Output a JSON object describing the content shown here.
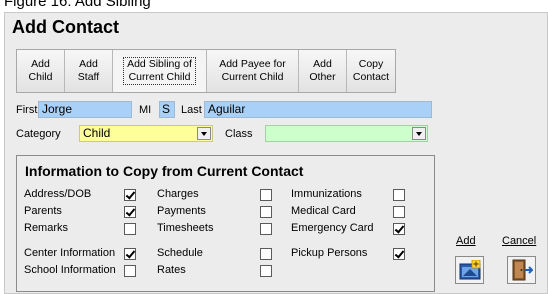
{
  "caption": "Figure 16: Add Sibling",
  "title": "Add Contact",
  "toolbar": [
    {
      "line1": "Add",
      "line2": "Child"
    },
    {
      "line1": "Add",
      "line2": "Staff"
    },
    {
      "line1": "Add Sibling of",
      "line2": "Current Child"
    },
    {
      "line1": "Add Payee for",
      "line2": "Current Child"
    },
    {
      "line1": "Add",
      "line2": "Other"
    },
    {
      "line1": "Copy",
      "line2": "Contact"
    }
  ],
  "fields": {
    "first_label": "First",
    "first_value": "Jorge",
    "mi_label": "MI",
    "mi_value": "S",
    "last_label": "Last",
    "last_value": "Aguilar",
    "category_label": "Category",
    "category_value": "Child",
    "class_label": "Class",
    "class_value": ""
  },
  "info": {
    "title": "Information to Copy from Current Contact",
    "options": [
      {
        "label": "Address/DOB",
        "checked": true
      },
      {
        "label": "Parents",
        "checked": true
      },
      {
        "label": "Remarks",
        "checked": false
      },
      {
        "label": "Center Information",
        "checked": true
      },
      {
        "label": "School Information",
        "checked": false
      },
      {
        "label": "Charges",
        "checked": false
      },
      {
        "label": "Payments",
        "checked": false
      },
      {
        "label": "Timesheets",
        "checked": false
      },
      {
        "label": "Schedule",
        "checked": false
      },
      {
        "label": "Rates",
        "checked": false
      },
      {
        "label": "Immunizations",
        "checked": false
      },
      {
        "label": "Medical Card",
        "checked": false
      },
      {
        "label": "Emergency Card",
        "checked": true
      },
      {
        "label": "Pickup Persons",
        "checked": true
      }
    ]
  },
  "actions": {
    "add_label": "Add",
    "cancel_label": "Cancel",
    "add_icon": "add-record-icon",
    "cancel_icon": "exit-door-icon"
  }
}
